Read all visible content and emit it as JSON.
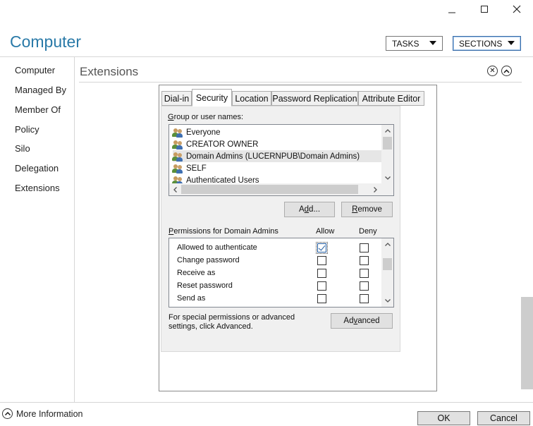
{
  "window": {
    "minimize": "minimize",
    "maximize": "maximize",
    "close": "close"
  },
  "header": {
    "title": "Computer",
    "tasks_label": "TASKS",
    "sections_label": "SECTIONS"
  },
  "nav": {
    "items": [
      {
        "label": "Computer"
      },
      {
        "label": "Managed By"
      },
      {
        "label": "Member Of"
      },
      {
        "label": "Policy"
      },
      {
        "label": "Silo"
      },
      {
        "label": "Delegation"
      },
      {
        "label": "Extensions"
      }
    ]
  },
  "section": {
    "title": "Extensions"
  },
  "tabs": [
    {
      "label": "Dial-in",
      "selected": false
    },
    {
      "label": "Security",
      "selected": true
    },
    {
      "label": "Location",
      "selected": false
    },
    {
      "label": "Password Replication",
      "selected": false
    },
    {
      "label": "Attribute Editor",
      "selected": false
    }
  ],
  "security": {
    "group_label_prefix": "G",
    "group_label_rest": "roup or user names:",
    "users": [
      {
        "name": "Everyone",
        "selected": false
      },
      {
        "name": "CREATOR OWNER",
        "selected": false
      },
      {
        "name": "Domain Admins (LUCERNPUB\\Domain Admins)",
        "selected": true
      },
      {
        "name": "SELF",
        "selected": false
      },
      {
        "name": "Authenticated Users",
        "selected": false
      }
    ],
    "add_button_pre": "A",
    "add_button_underline": "d",
    "add_button_post": "d...",
    "remove_button_underline": "R",
    "remove_button_post": "emove",
    "permissions_label_underline": "P",
    "permissions_label_rest": "ermissions for Domain Admins",
    "allow_header": "Allow",
    "deny_header": "Deny",
    "permissions": [
      {
        "name": "Allowed to authenticate",
        "allow": true,
        "deny": false
      },
      {
        "name": "Change password",
        "allow": false,
        "deny": false
      },
      {
        "name": "Receive as",
        "allow": false,
        "deny": false
      },
      {
        "name": "Reset password",
        "allow": false,
        "deny": false
      },
      {
        "name": "Send as",
        "allow": false,
        "deny": false
      }
    ],
    "advanced_note": "For special permissions or advanced settings, click Advanced.",
    "advanced_button_pre": "Ad",
    "advanced_button_underline": "v",
    "advanced_button_post": "anced"
  },
  "footer": {
    "more_info": "More Information",
    "ok_label": "OK",
    "cancel_label": "Cancel"
  }
}
